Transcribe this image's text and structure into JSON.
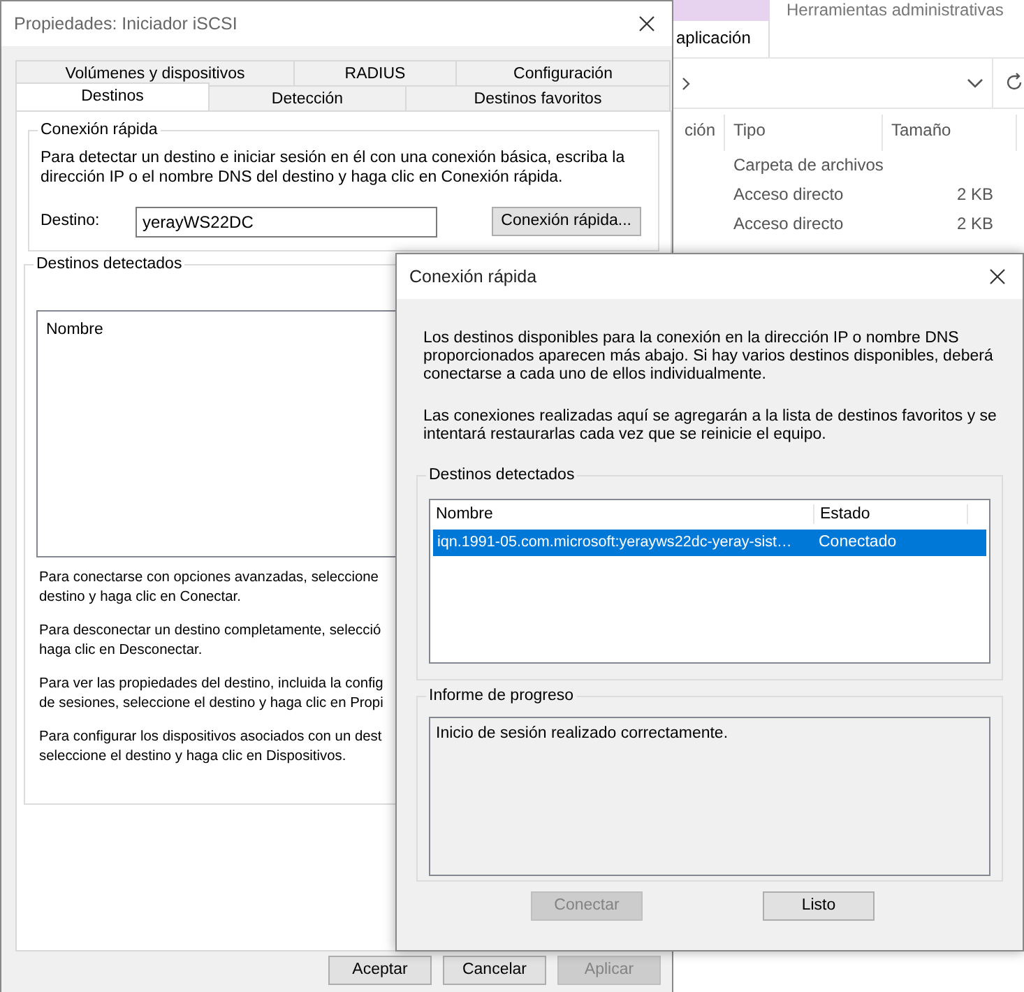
{
  "explorer": {
    "ribbon_tabs": [
      {
        "label": "aplicación"
      },
      {
        "label": "Herramientas administrativas"
      }
    ],
    "columns": [
      "ción",
      "Tipo",
      "Tamaño"
    ],
    "rows": [
      {
        "type": "Carpeta de archivos"
      },
      {
        "type": "Acceso directo",
        "size": "2 KB"
      },
      {
        "type": "Acceso directo",
        "size": "2 KB"
      }
    ]
  },
  "main_dialog": {
    "title": "Propiedades: Iniciador iSCSI",
    "tab_rows": [
      {
        "tabs": [
          {
            "label": "Volúmenes y dispositivos",
            "selected": false
          },
          {
            "label": "RADIUS",
            "selected": false
          },
          {
            "label": "Configuración",
            "selected": false
          }
        ]
      },
      {
        "tabs": [
          {
            "label": "Destinos",
            "selected": true
          },
          {
            "label": "Detección",
            "selected": false
          },
          {
            "label": "Destinos favoritos",
            "selected": false
          }
        ]
      }
    ],
    "quick_connect": {
      "title": "Conexión rápida",
      "text": "Para detectar un destino e iniciar sesión en él con una conexión básica, escriba la dirección IP o el nombre DNS del destino y haga clic en Conexión rápida.",
      "target_label": "Destino:",
      "target_value": "yerayWS22DC",
      "button": "Conexión rápida..."
    },
    "discovered": {
      "title": "Destinos detectados",
      "list_header": "Nombre",
      "notes": [
        {
          "lines": [
            "Para conectarse con opciones avanzadas, seleccione",
            "destino y haga clic en Conectar."
          ]
        },
        {
          "lines": [
            "Para desconectar un destino completamente, selecció",
            "haga clic en Desconectar."
          ]
        },
        {
          "lines": [
            "Para ver las propiedades del destino, incluida la config",
            "de sesiones, seleccione el destino y haga clic en Propi"
          ]
        },
        {
          "lines": [
            "Para configurar los dispositivos asociados con un dest",
            "seleccione el destino y haga clic en Dispositivos."
          ]
        }
      ]
    },
    "buttons": [
      {
        "label": "Aceptar",
        "disabled": false
      },
      {
        "label": "Cancelar",
        "disabled": false
      },
      {
        "label": "Aplicar",
        "disabled": true
      }
    ]
  },
  "quick_dialog": {
    "title": "Conexión rápida",
    "paragraphs": [
      "Los destinos disponibles para la conexión en la dirección IP o nombre DNS proporcionados aparecen más abajo. Si hay varios destinos disponibles, deberá conectarse a cada uno de ellos individualmente.",
      "Las conexiones realizadas aquí se agregarán a la lista de destinos favoritos y se intentará restaurarlas cada vez que se reinicie el equipo."
    ],
    "targets": {
      "title": "Destinos detectados",
      "columns": [
        "Nombre",
        "Estado"
      ],
      "rows": [
        {
          "name": "iqn.1991-05.com.microsoft:yerayws22dc-yeray-sist…",
          "status": "Conectado",
          "selected": true
        }
      ]
    },
    "progress": {
      "title": "Informe de progreso",
      "text": "Inicio de sesión realizado correctamente."
    },
    "buttons": [
      {
        "label": "Conectar",
        "disabled": true
      },
      {
        "label": "Listo",
        "disabled": false
      }
    ]
  }
}
